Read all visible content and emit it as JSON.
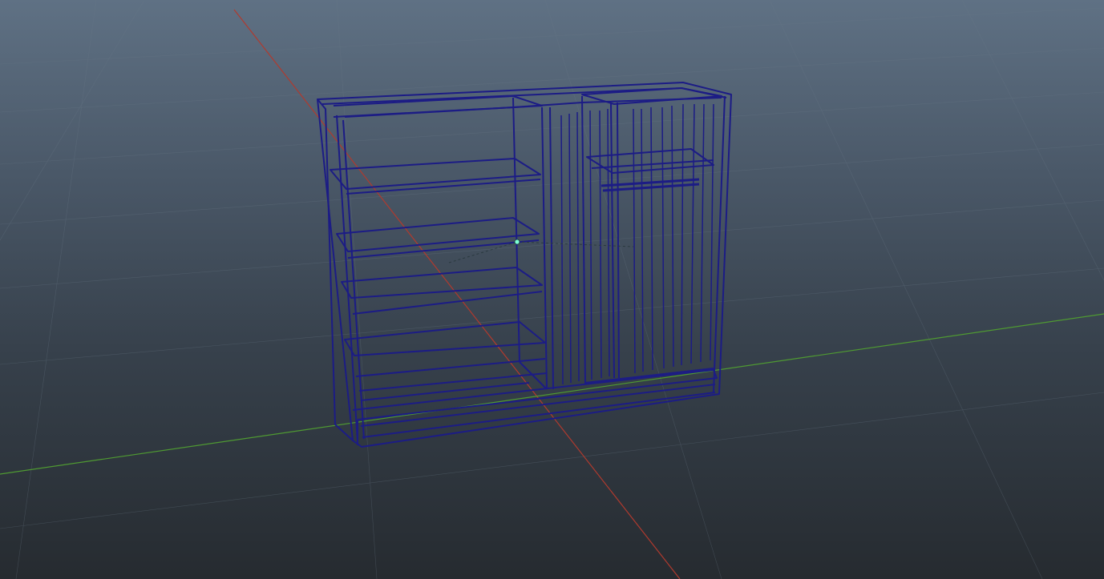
{
  "viewport": {
    "background_top": "#5f7184",
    "background_bottom": "#262b30"
  },
  "scene": {
    "grid_color": "#6b7a88",
    "axis_x_color": "#b03a2e",
    "axis_z_color": "#4f9a32",
    "wireframe_color": "#1c1c85",
    "pivot_color": "#7fffd4"
  },
  "object": {
    "name_icon": "wardrobe-wireframe"
  }
}
